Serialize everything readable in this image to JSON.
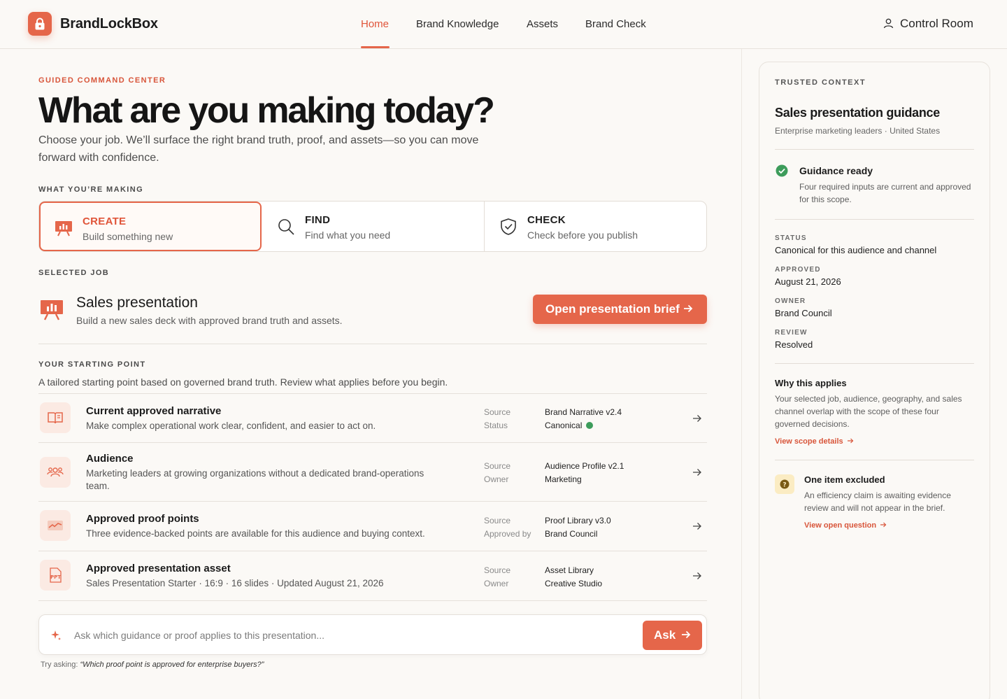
{
  "header": {
    "brand": "BrandLockBox",
    "nav": [
      "Home",
      "Brand Knowledge",
      "Assets",
      "Brand Check"
    ],
    "active_nav": "Home",
    "control_room": "Control Room"
  },
  "hero": {
    "eyebrow": "GUIDED COMMAND CENTER",
    "title": "What are you making today?",
    "lead": "Choose your job. We’ll surface the right brand truth, proof, and assets—so you can move forward with confidence."
  },
  "making": {
    "label": "WHAT YOU’RE MAKING",
    "options": [
      {
        "title": "CREATE",
        "sub": "Build something new",
        "icon": "presentation-icon",
        "active": true
      },
      {
        "title": "FIND",
        "sub": "Find what you need",
        "icon": "search-icon",
        "active": false
      },
      {
        "title": "CHECK",
        "sub": "Check before you publish",
        "icon": "shield-check-icon",
        "active": false
      }
    ]
  },
  "selected_job": {
    "label": "SELECTED JOB",
    "title": "Sales presentation",
    "sub": "Build a new sales deck with approved brand truth and assets.",
    "cta": "Open presentation brief"
  },
  "starting_point": {
    "label": "YOUR STARTING POINT",
    "sub": "A tailored starting point based on governed brand truth. Review what applies before you begin.",
    "rows": [
      {
        "icon": "book-icon",
        "title": "Current approved narrative",
        "desc": "Make complex operational work clear, confident, and easier to act on.",
        "k1": "Source",
        "v1": "Brand Narrative v2.4",
        "k2": "Status",
        "v2": "Canonical"
      },
      {
        "icon": "audience-icon",
        "title": "Audience",
        "desc": "Marketing leaders at growing organizations without a dedicated brand-operations team.",
        "k1": "Source",
        "v1": "Audience Profile v2.1",
        "k2": "Owner",
        "v2": "Marketing"
      },
      {
        "icon": "proof-chart-icon",
        "title": "Approved proof points",
        "desc": "Three evidence-backed points are available for this audience and buying context.",
        "k1": "Source",
        "v1": "Proof Library v3.0",
        "k2": "Approved by",
        "v2": "Brand Council"
      },
      {
        "icon": "ppt-file-icon",
        "title": "Approved presentation asset",
        "desc": "Sales Presentation Starter · 16:9 · 16 slides · Updated August 21, 2026",
        "k1": "Source",
        "v1": "Asset Library",
        "k2": "Owner",
        "v2": "Creative Studio"
      }
    ]
  },
  "ask": {
    "placeholder": "Ask which guidance or proof applies to this presentation...",
    "button": "Ask",
    "hint_prefix": "Try asking:",
    "hint_example": "“Which proof point is approved for enterprise buyers?”"
  },
  "panel": {
    "eyebrow": "TRUSTED CONTEXT",
    "title": "Sales presentation guidance",
    "sub": "Enterprise marketing leaders · United States",
    "ready_title": "Guidance ready",
    "ready_body": "Four required inputs are current and approved for this scope.",
    "status_label": "STATUS",
    "status_value": "Canonical for this audience and channel",
    "approved_label": "APPROVED",
    "approved_value": "August 21, 2026",
    "owner_label": "OWNER",
    "owner_value": "Brand Council",
    "review_label": "REVIEW",
    "review_value": "Resolved",
    "why_title": "Why this applies",
    "why_body": "Your selected job, audience, geography, and sales channel overlap with the scope of these four governed decisions.",
    "why_link": "View scope details",
    "excluded_title": "One item excluded",
    "excluded_body": "An efficiency claim is awaiting evidence review and will not appear in the brief.",
    "excluded_link": "View open question"
  },
  "colors": {
    "accent": "#e5664a",
    "success": "#3d9c5b",
    "warning_bg": "#fbecc3"
  }
}
